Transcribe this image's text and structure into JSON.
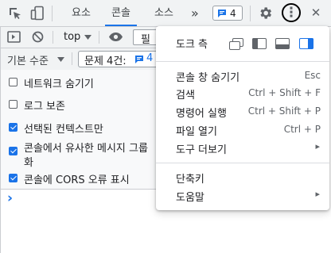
{
  "topbar": {
    "tabs": [
      {
        "label": "요소"
      },
      {
        "label": "콘솔"
      },
      {
        "label": "소스"
      }
    ],
    "more_tabs": "»",
    "issues_count": "4",
    "kebab_glyph": "⋮",
    "close_glyph": "✕"
  },
  "console_toolbar": {
    "context": "top",
    "filter_placeholder": "필터"
  },
  "level_bar": {
    "levels_label": "기본 수준",
    "issues_label": "문제 4건:",
    "issues_count": "4"
  },
  "settings": [
    {
      "label": "네트워크 숨기기",
      "checked": false
    },
    {
      "label": "로그 보존",
      "checked": false
    },
    {
      "label": "선택된 컨텍스트만",
      "checked": true
    },
    {
      "label_line1": "콘솔에서 유사한 메시지 그룹",
      "label_line2": "화",
      "checked": true
    },
    {
      "label": "콘솔에 CORS 오류 표시",
      "checked": true
    }
  ],
  "prompt_glyph": "›",
  "menu": {
    "dock_side_label": "도크 측",
    "items": [
      {
        "label": "콘솔 창 숨기기",
        "shortcut": "Esc"
      },
      {
        "label": "검색",
        "shortcut": "Ctrl + Shift + F"
      },
      {
        "label": "명령어 실행",
        "shortcut": "Ctrl + Shift + P"
      },
      {
        "label": "파일 열기",
        "shortcut": "Ctrl + P"
      },
      {
        "label": "도구 더보기",
        "shortcut": ""
      }
    ],
    "items2": [
      {
        "label": "단축키"
      },
      {
        "label": "도움말"
      }
    ],
    "submenu_arrow": "▸"
  },
  "colors": {
    "accent": "#1a73e8",
    "toolbar_bg": "#f1f3f4"
  }
}
